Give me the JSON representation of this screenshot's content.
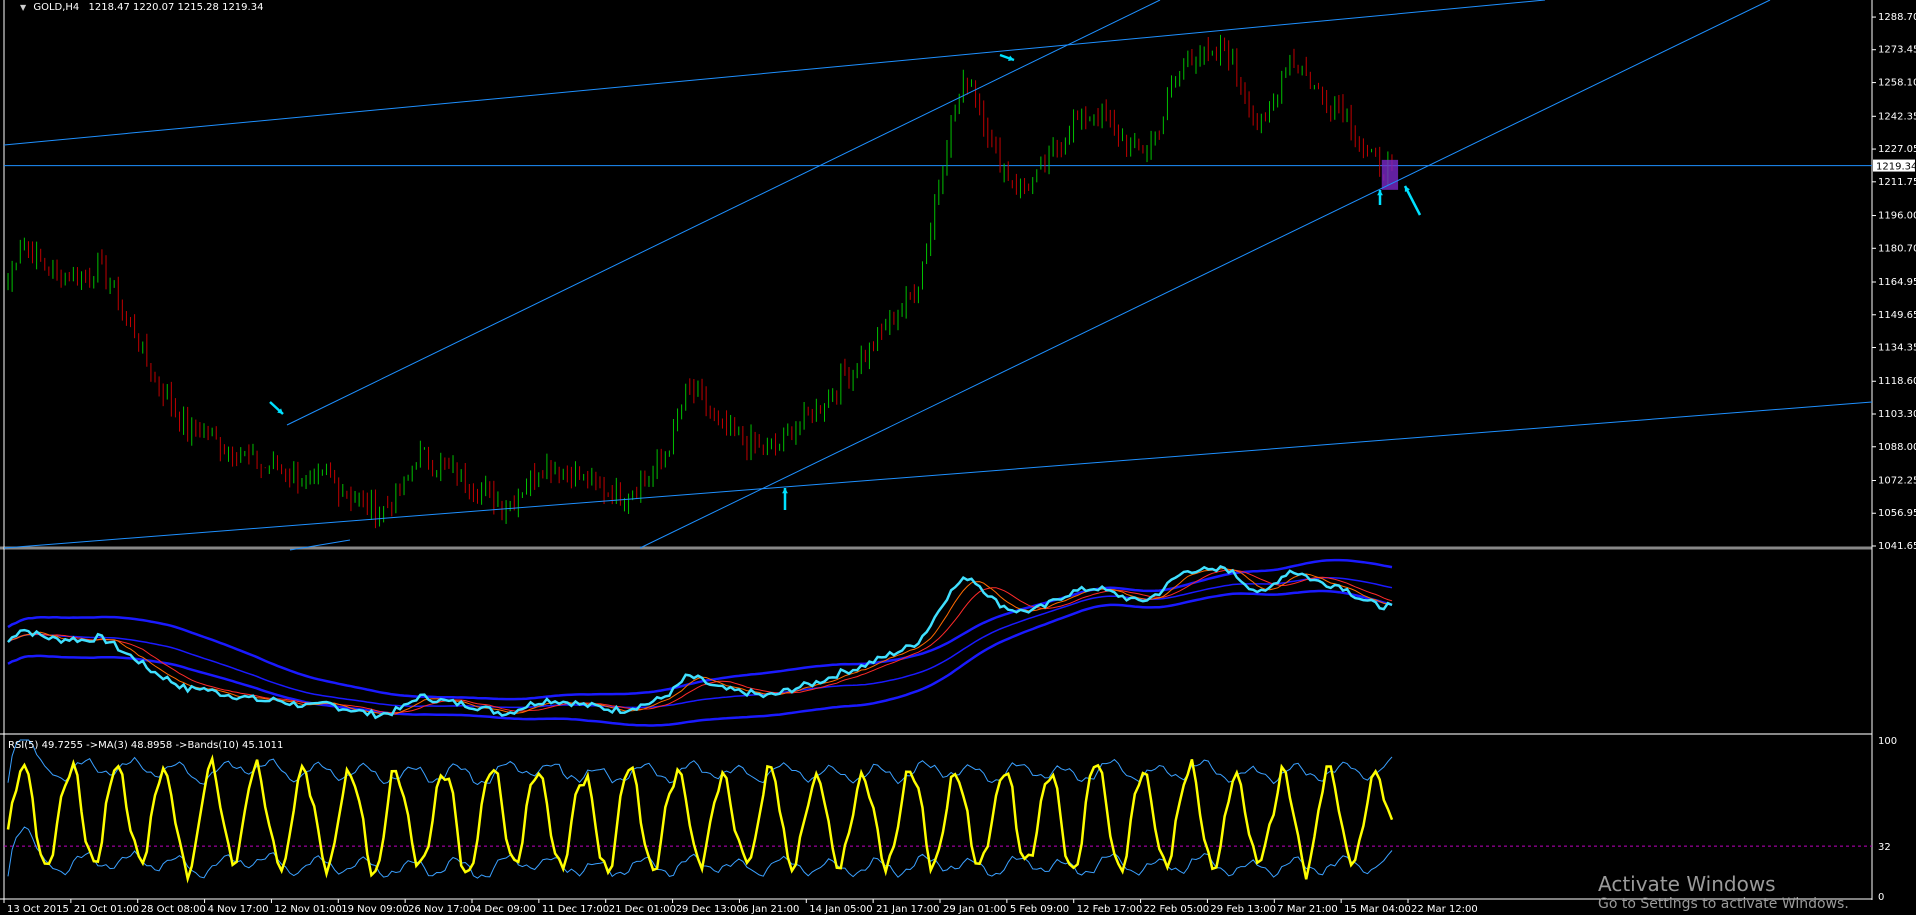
{
  "window": {
    "symbol_title": "GOLD,H4",
    "ohlc": "1218.47 1220.07 1215.28 1219.34"
  },
  "watermark": {
    "line1": "Activate Windows",
    "line2": "Go to Settings to activate Windows."
  },
  "colors": {
    "background": "#000000",
    "bull": "#00c000",
    "bear": "#c00000",
    "channel_line": "#1e90ff",
    "band": "#1a1aff",
    "close_cyan": "#40e0ff",
    "ma_fast": "#ff6a00",
    "ma_slow": "#ff2a2a",
    "rsi": "#ffff00",
    "rsi_bands": "#3aa0ff",
    "rsi_level": "#c000c0",
    "arrow": "#00e0ff",
    "grid_axis": "#ffffff"
  },
  "chart_data": [
    {
      "type": "line",
      "title": "GOLD,H4",
      "subtitle": "1218.47 1220.07 1215.28 1219.34",
      "series": [
        {
          "name": "GOLD,H4",
          "style": "candlestick-approx",
          "values": [
            1165,
            1185,
            1178,
            1172,
            1168,
            1170,
            1167,
            1172,
            1165,
            1150,
            1140,
            1125,
            1115,
            1105,
            1095,
            1098,
            1092,
            1088,
            1085,
            1082,
            1078,
            1080,
            1075,
            1072,
            1070,
            1075,
            1068,
            1065,
            1060,
            1058,
            1062,
            1070,
            1085,
            1082,
            1078,
            1075,
            1072,
            1068,
            1063,
            1060,
            1068,
            1075,
            1080,
            1078,
            1076,
            1072,
            1070,
            1066,
            1065,
            1070,
            1075,
            1082,
            1095,
            1115,
            1110,
            1100,
            1095,
            1092,
            1090,
            1085,
            1088,
            1095,
            1100,
            1105,
            1112,
            1120,
            1125,
            1132,
            1140,
            1148,
            1155,
            1165,
            1190,
            1225,
            1248,
            1262,
            1245,
            1225,
            1215,
            1210,
            1212,
            1218,
            1230,
            1238,
            1242,
            1245,
            1238,
            1232,
            1225,
            1228,
            1240,
            1258,
            1270,
            1272,
            1268,
            1275,
            1260,
            1245,
            1235,
            1255,
            1270,
            1265,
            1255,
            1250,
            1248,
            1235,
            1225,
            1218,
            1219
          ]
        },
        {
          "name": "Current Price",
          "values": [
            1219.34
          ]
        }
      ],
      "x_tick_labels": [
        "13 Oct 2015",
        "21 Oct 01:00",
        "28 Oct 08:00",
        "4 Nov 17:00",
        "12 Nov 01:00",
        "19 Nov 09:00",
        "26 Nov 17:00",
        "4 Dec 09:00",
        "11 Dec 17:00",
        "21 Dec 01:00",
        "29 Dec 13:00",
        "6 Jan 21:00",
        "14 Jan 05:00",
        "21 Jan 17:00",
        "29 Jan 01:00",
        "5 Feb 09:00",
        "12 Feb 17:00",
        "22 Feb 05:00",
        "29 Feb 13:00",
        "7 Mar 21:00",
        "15 Mar 04:00",
        "22 Mar 12:00"
      ],
      "y_tick_labels": [
        "1288.70",
        "1273.45",
        "1258.10",
        "1242.35",
        "1227.05",
        "1211.75",
        "1196.00",
        "1180.70",
        "1164.95",
        "1149.65",
        "1134.35",
        "1118.60",
        "1103.30",
        "1088.00",
        "1072.25",
        "1056.95",
        "1041.65"
      ],
      "y_current_label": "1219.34",
      "ylim": [
        1041.65,
        1292
      ],
      "grid": false
    },
    {
      "type": "line",
      "title": "",
      "series": [
        {
          "name": "",
          "role": "upper-band"
        },
        {
          "name": "",
          "role": "lower-band"
        },
        {
          "name": "",
          "role": "mid"
        },
        {
          "name": "",
          "role": "ma-fast"
        },
        {
          "name": "",
          "role": "ma-slow"
        }
      ]
    },
    {
      "type": "line",
      "title": "RSI(5) 49.7255  ->MA(3) 48.8958  ->Bands(10) 45.1011",
      "y_tick_labels": [
        "100",
        "32",
        "0"
      ],
      "ylim": [
        0,
        100
      ],
      "level": 32,
      "series": [
        {
          "name": "RSI(5) 49.7255"
        },
        {
          "name": "->MA(3) 48.8958"
        },
        {
          "name": "->Bands(10) 45.1011"
        }
      ]
    }
  ]
}
